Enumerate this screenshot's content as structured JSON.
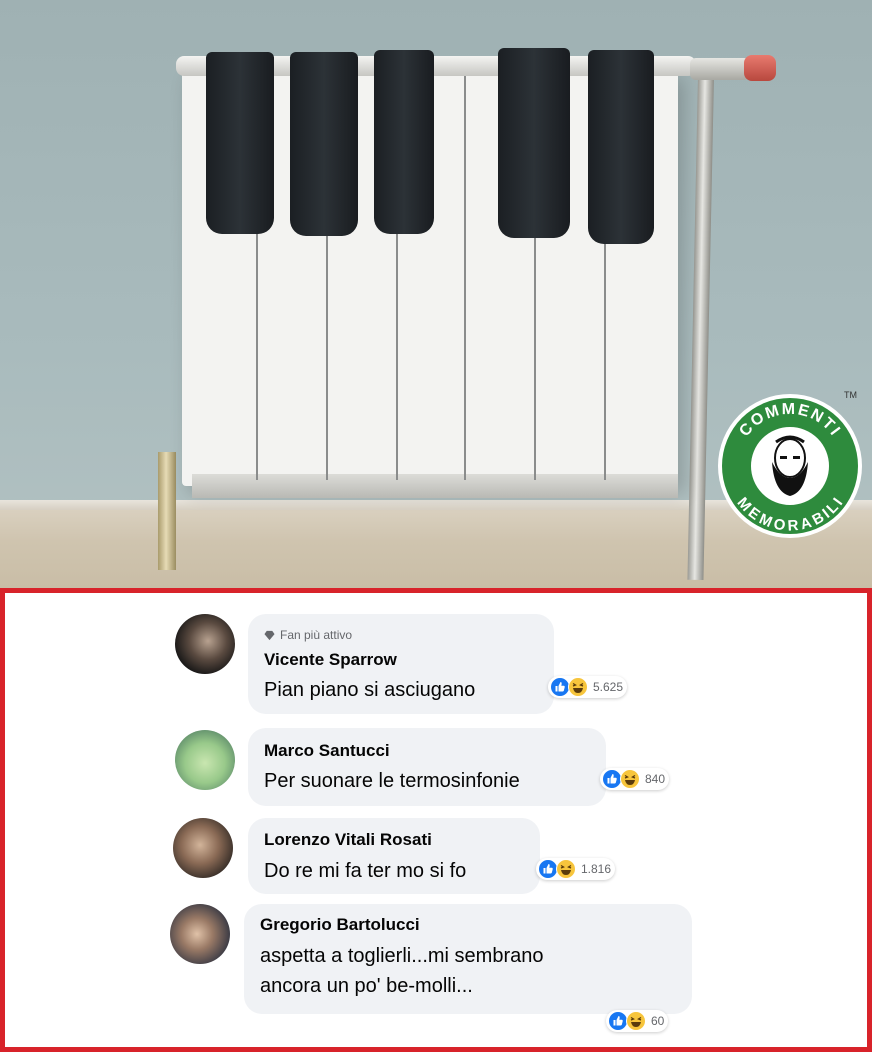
{
  "badge": {
    "top_text": "COMMENTI",
    "bottom_text": "MEMORABILI",
    "trademark": "TM"
  },
  "comments": [
    {
      "fan_label": "Fan più attivo",
      "author": "Vicente Sparrow",
      "text": "Pian piano si asciugano",
      "reaction_count": "5.625"
    },
    {
      "author": "Marco Santucci",
      "text": "Per suonare le termosinfonie",
      "reaction_count": "840"
    },
    {
      "author": "Lorenzo Vitali Rosati",
      "text": "Do re mi fa ter mo si fo",
      "reaction_count": "1.816"
    },
    {
      "author": "Gregorio Bartolucci",
      "text_line1": "aspetta a toglierli...mi sembrano",
      "text_line2": "ancora un po' be-molli...",
      "reaction_count": "60"
    }
  ],
  "colors": {
    "frame_red": "#d8232a",
    "badge_green": "#2e8b3d",
    "like_blue": "#1877f2",
    "haha_yellow": "#f7c53c",
    "bubble_bg": "#f0f2f5"
  },
  "icons": [
    "like-icon",
    "haha-icon",
    "diamond-icon"
  ]
}
